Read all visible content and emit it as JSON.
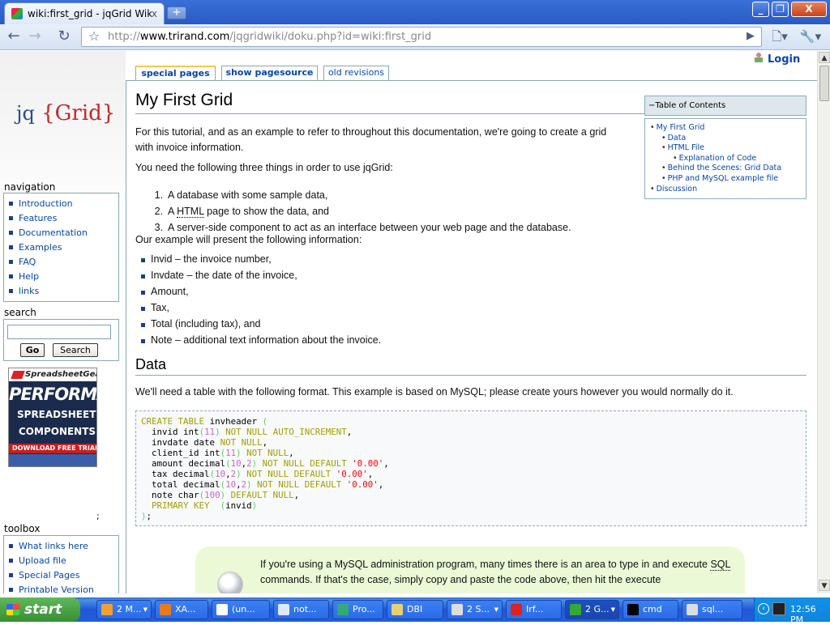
{
  "browser": {
    "tab_title": "wiki:first_grid - jqGrid Wiki",
    "tab_close": "x",
    "new_tab": "+",
    "url_proto": "http://",
    "url_host": "www.trirand.com",
    "url_path": "/jqgridwiki/doku.php?id=wiki:first_grid",
    "window_buttons": {
      "min": "_",
      "max": "❐",
      "close": "X"
    }
  },
  "page_tabs": {
    "special": "special pages",
    "source": "show pagesource",
    "revisions": "old revisions"
  },
  "login": "Login",
  "logo": {
    "jq": "jq",
    "grid": "{Grid}"
  },
  "navigation": {
    "title": "navigation",
    "items": [
      "Introduction",
      "Features",
      "Documentation",
      "Examples",
      "FAQ",
      "Help",
      "links"
    ]
  },
  "search": {
    "title": "search",
    "go": "Go",
    "search": "Search",
    "value": ""
  },
  "ad": {
    "brand": "SpreadsheetGear",
    "line1": "PERFORMANCE",
    "line2": "SPREADSHEET",
    "line3": "COMPONENTS",
    "cta": "DOWNLOAD FREE TRIAL"
  },
  "semicolon": ";",
  "toolbox": {
    "title": "toolbox",
    "items": [
      "What links here",
      "Upload file",
      "Special Pages",
      "Printable Version"
    ]
  },
  "content": {
    "title": "My First Grid",
    "intro_line1": "For this tutorial, and as an example to refer to throughout this documentation, we're going to create a grid",
    "intro_line2": "with invoice information.",
    "need": "You need the following three things in order to use jqGrid:",
    "ol": [
      {
        "n": "1.",
        "pre": "A database with some sample data,",
        "abbr": "",
        "post": ""
      },
      {
        "n": "2.",
        "pre": "A ",
        "abbr": "HTML",
        "post": " page to show the data, and"
      },
      {
        "n": "3.",
        "pre": "A server-side component to act as an interface between your web page and the database.",
        "abbr": "",
        "post": ""
      }
    ],
    "example": "Our example will present the following information:",
    "ul": [
      "Invid – the invoice number,",
      "Invdate – the date of the invoice,",
      "Amount,",
      "Tax,",
      "Total (including tax), and",
      "Note – additional text information about the invoice."
    ],
    "data_heading": "Data",
    "data_para": "We'll need a table with the following format. This example is based on MySQL; please create yours however you would normally do it.",
    "code": [
      "CREATE TABLE invheader (",
      "  invid int(11) NOT NULL AUTO_INCREMENT,",
      "  invdate date NOT NULL,",
      "  client_id int(11) NOT NULL,",
      "  amount decimal(10,2) NOT NULL DEFAULT '0.00',",
      "  tax decimal(10,2) NOT NULL DEFAULT '0.00',",
      "  total decimal(10,2) NOT NULL DEFAULT '0.00',",
      "  note char(100) DEFAULT NULL,",
      "  PRIMARY KEY  (invid)",
      ");"
    ],
    "note_pre": "If you're using a MySQL administration program, many times there is an area to type in and execute ",
    "note_sql": "SQL",
    "note_post": " commands. If that's the case, simply copy and paste the code above, then hit the execute"
  },
  "toc": {
    "head": "−Table of Contents",
    "items": [
      {
        "level": 1,
        "text": "My First Grid"
      },
      {
        "level": 2,
        "text": "Data"
      },
      {
        "level": 2,
        "text": "HTML File"
      },
      {
        "level": 3,
        "text": "Explanation of Code"
      },
      {
        "level": 2,
        "text": "Behind the Scenes: Grid Data"
      },
      {
        "level": 2,
        "text": "PHP and MySQL example file"
      },
      {
        "level": 1,
        "text": "Discussion"
      }
    ]
  },
  "taskbar": {
    "start": "start",
    "tasks": [
      {
        "label": "2 M...",
        "color": "#f0a030"
      },
      {
        "label": "XA...",
        "color": "#e87a1e"
      },
      {
        "label": "(un...",
        "color": "#fff"
      },
      {
        "label": "not...",
        "color": "#dfe8f8"
      },
      {
        "label": "Pro...",
        "color": "#3a7"
      },
      {
        "label": "DBI",
        "color": "#e8d070"
      },
      {
        "label": "2 S...",
        "color": "#ddd"
      },
      {
        "label": "Irf...",
        "color": "#d22"
      },
      {
        "label": "2 G...",
        "color": "#3a3"
      },
      {
        "label": "cmd",
        "color": "#000"
      },
      {
        "label": "sql...",
        "color": "#ddd"
      }
    ],
    "clock": "12:56 PM"
  },
  "colors": {
    "link": "#0645ad",
    "accent_tab": "#f7c84c",
    "note_bg": "#ebf9d7",
    "xp_blue": "#245edb"
  }
}
